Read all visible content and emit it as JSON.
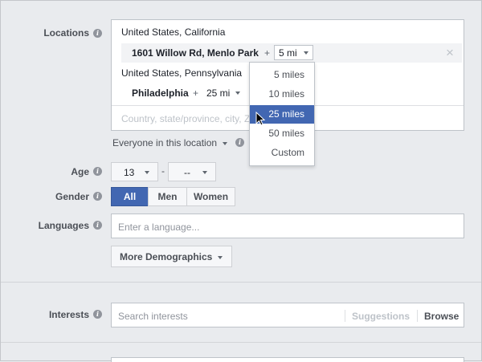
{
  "locations": {
    "label": "Locations",
    "group1_title": "United States, California",
    "group1_place": "1601 Willow Rd, Menlo Park",
    "group1_plus": "+",
    "group1_radius": "5 mi",
    "remove_symbol": "×",
    "group2_title": "United States, Pennsylvania",
    "group2_place": "Philadelphia",
    "group2_plus": "+",
    "group2_radius": "25 mi",
    "input_placeholder": "Country, state/province, city, ZIP",
    "audience_type": "Everyone in this location"
  },
  "radius_dropdown": {
    "options": [
      "5 miles",
      "10 miles",
      "25 miles",
      "50 miles",
      "Custom"
    ],
    "selected": "25 miles"
  },
  "age": {
    "label": "Age",
    "min": "13",
    "separator": "-",
    "max": "--"
  },
  "gender": {
    "label": "Gender",
    "options": [
      "All",
      "Men",
      "Women"
    ],
    "selected": "All"
  },
  "languages": {
    "label": "Languages",
    "placeholder": "Enter a language..."
  },
  "more_demographics": {
    "label": "More Demographics"
  },
  "interests": {
    "label": "Interests",
    "placeholder": "Search interests",
    "suggestions_label": "Suggestions",
    "browse_label": "Browse"
  },
  "colors": {
    "accent": "#4267b2",
    "background": "#e9ebee"
  }
}
